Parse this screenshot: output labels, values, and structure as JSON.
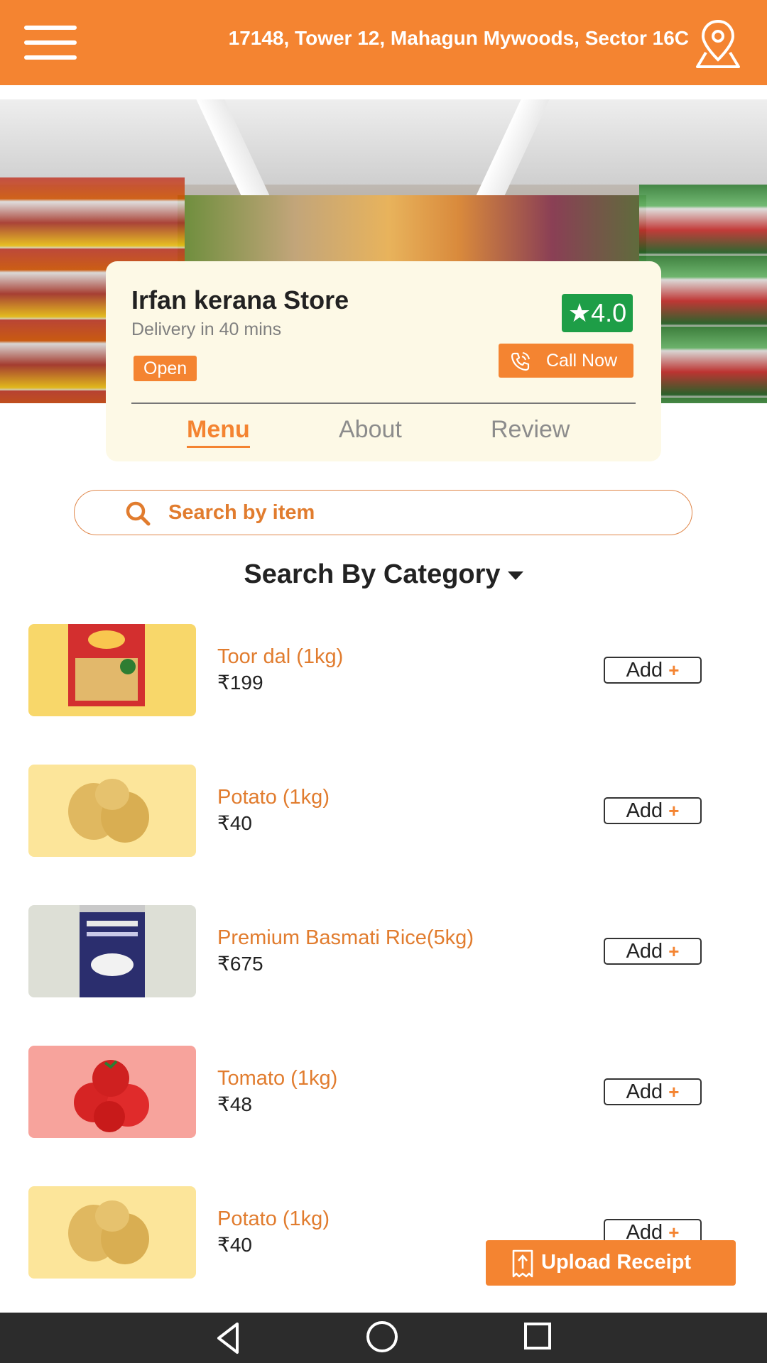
{
  "header": {
    "address": "17148, Tower 12, Mahagun Mywoods, Sector 16C",
    "menu_icon": "hamburger-menu-icon",
    "location_icon": "location-pin-icon"
  },
  "store": {
    "name": "Irfan kerana Store",
    "delivery": "Delivery in 40 mins",
    "status": "Open",
    "rating": "★4.0",
    "call_label": "Call Now"
  },
  "tabs": [
    {
      "label": "Menu",
      "active": true
    },
    {
      "label": "About",
      "active": false
    },
    {
      "label": "Review",
      "active": false
    }
  ],
  "search": {
    "placeholder": "Search by item"
  },
  "category": {
    "label": "Search By Category"
  },
  "products": [
    {
      "name": "Toor dal (1kg)",
      "price": "₹199",
      "add_label": "Add",
      "add_plus": "+"
    },
    {
      "name": "Potato (1kg)",
      "price": "₹40",
      "add_label": "Add",
      "add_plus": "+"
    },
    {
      "name": "Premium Basmati Rice(5kg)",
      "price": "₹675",
      "add_label": "Add",
      "add_plus": "+"
    },
    {
      "name": "Tomato (1kg)",
      "price": "₹48",
      "add_label": "Add",
      "add_plus": "+"
    },
    {
      "name": "Potato (1kg)",
      "price": "₹40",
      "add_label": "Add",
      "add_plus": "+"
    }
  ],
  "upload": {
    "label": "Upload Receipt"
  },
  "colors": {
    "brand": "#F48431",
    "rating": "#1E9E47",
    "card": "#FDF9E6"
  }
}
